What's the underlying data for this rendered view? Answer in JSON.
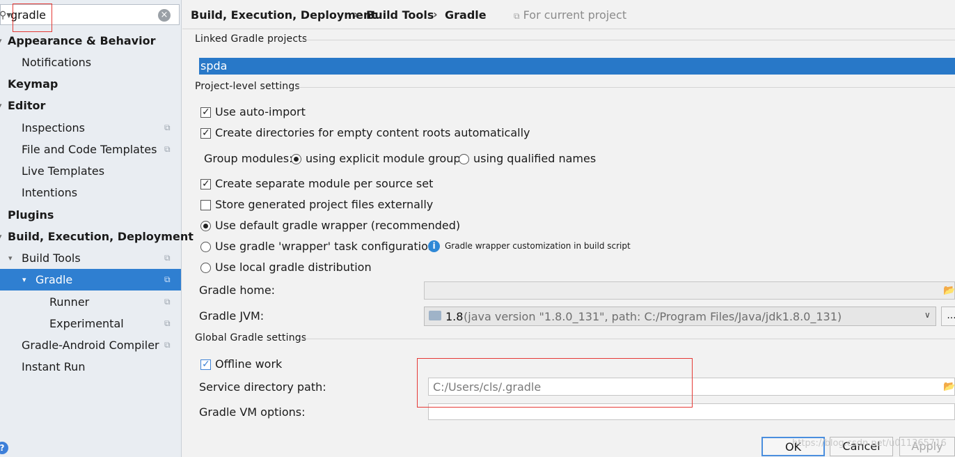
{
  "search": {
    "value": "gradle",
    "clear_icon": "clear-icon",
    "search_icon": "search-icon"
  },
  "sidebar": {
    "items": [
      {
        "label": "Appearance & Behavior"
      },
      {
        "label": "Notifications"
      },
      {
        "label": "Keymap"
      },
      {
        "label": "Editor"
      },
      {
        "label": "Inspections"
      },
      {
        "label": "File and Code Templates"
      },
      {
        "label": "Live Templates"
      },
      {
        "label": "Intentions"
      },
      {
        "label": "Plugins"
      },
      {
        "label": "Build, Execution, Deployment"
      },
      {
        "label": "Build Tools"
      },
      {
        "label": "Gradle"
      },
      {
        "label": "Runner"
      },
      {
        "label": "Experimental"
      },
      {
        "label": "Gradle-Android Compiler"
      },
      {
        "label": "Instant Run"
      }
    ]
  },
  "header": {
    "crumbs": [
      "Build, Execution, Deployment",
      "Build Tools",
      "Gradle"
    ],
    "separator": "›",
    "scope": "For current project"
  },
  "linked": {
    "title": "Linked Gradle projects",
    "project": "spda"
  },
  "project_level": {
    "title": "Project-level settings",
    "auto_import": {
      "label": "Use auto-import",
      "checked": true
    },
    "create_dirs": {
      "label": "Create directories for empty content roots automatically",
      "checked": true
    },
    "group_modules": {
      "label": "Group modules:",
      "explicit": "using explicit module groups",
      "qualified": "using qualified names",
      "selected": "explicit"
    },
    "separate_module": {
      "label": "Create separate module per source set",
      "checked": true
    },
    "store_external": {
      "label": "Store generated project files externally",
      "checked": false
    },
    "wrapper_default": "Use default gradle wrapper (recommended)",
    "wrapper_task": "Use gradle 'wrapper' task configuration",
    "wrapper_hint": "Gradle wrapper customization in build script",
    "local_dist": "Use local gradle distribution",
    "distribution_selected": "default",
    "gradle_home_label": "Gradle home:",
    "gradle_home_value": "",
    "gradle_jvm_label": "Gradle JVM:",
    "gradle_jvm_version": "1.8",
    "gradle_jvm_detail": "(java version \"1.8.0_131\", path: C:/Program Files/Java/jdk1.8.0_131)",
    "more_label": "..."
  },
  "global": {
    "title": "Global Gradle settings",
    "offline": {
      "label": "Offline work",
      "checked": true
    },
    "service_dir_label": "Service directory path:",
    "service_dir_value": "C:/Users/cls/.gradle",
    "vm_options_label": "Gradle VM options:",
    "vm_options_value": ""
  },
  "footer": {
    "ok": "OK",
    "cancel": "Cancel",
    "apply": "Apply",
    "help": "?",
    "watermark": "https://blog.csdn.net/u011365716"
  },
  "colors": {
    "selection": "#2f7fd1",
    "linked_row": "#2878c8",
    "highlight_box": "#e53935"
  }
}
